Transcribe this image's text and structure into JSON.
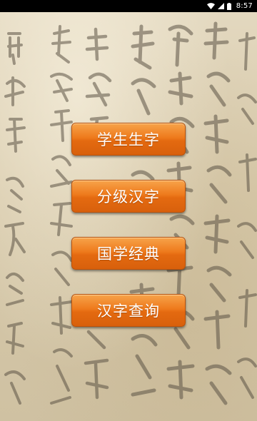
{
  "status_bar": {
    "time": "8:57",
    "icons": [
      "wifi-icon",
      "signal-icon",
      "battery-icon"
    ]
  },
  "menu": {
    "items": [
      {
        "label": "学生生字"
      },
      {
        "label": "分级汉字"
      },
      {
        "label": "国学经典"
      },
      {
        "label": "汉字查询"
      }
    ]
  },
  "theme": {
    "button_color": "#e8731a",
    "background_color": "#d9cdb2",
    "status_bar_color": "#000000"
  }
}
